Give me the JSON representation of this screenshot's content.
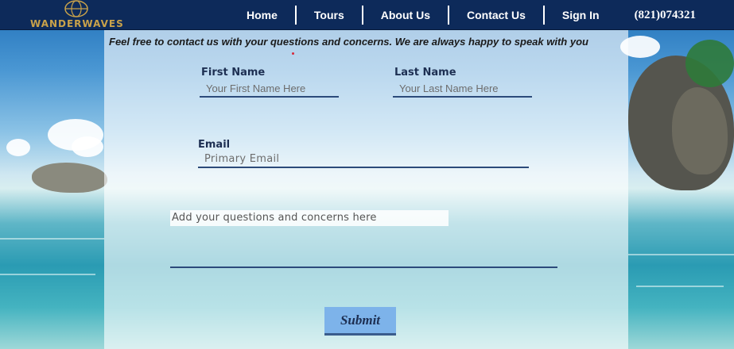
{
  "brand": {
    "name": "WANDERWAVES",
    "logo_icon": "globe-icon"
  },
  "nav": {
    "links": [
      "Home",
      "Tours",
      "About Us",
      "Contact Us",
      "Sign In"
    ],
    "phone": "(821)074321"
  },
  "contact": {
    "intro": "Feel free to contact us with your questions and concerns. We are always happy to speak with you",
    "first_name": {
      "label": "First Name",
      "placeholder": "Your First Name Here"
    },
    "last_name": {
      "label": "Last Name",
      "placeholder": "Your Last Name Here"
    },
    "email": {
      "label": "Email",
      "placeholder": "Primary Email"
    },
    "message": {
      "placeholder": "Add your questions and concerns here"
    },
    "submit_label": "Submit"
  },
  "colors": {
    "nav_bg": "#0d2a5a",
    "logo_gold": "#c9a24a",
    "field_underline": "#2c4a7a",
    "submit_bg": "#7db3ea"
  }
}
